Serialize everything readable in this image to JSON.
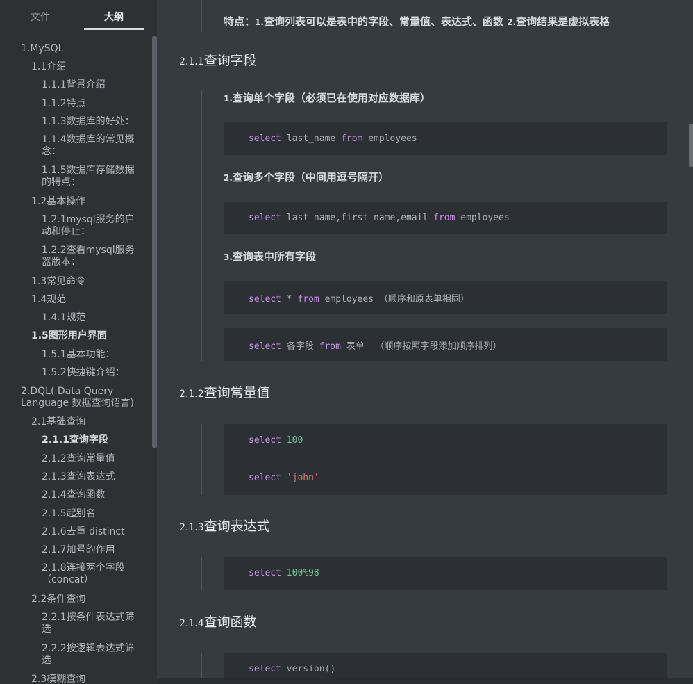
{
  "sidebar": {
    "tabs": [
      {
        "label": "文件"
      },
      {
        "label": "大纲"
      }
    ],
    "outline": [
      {
        "label": "1.MySQL"
      },
      {
        "label": "1.1介绍"
      },
      {
        "label": "1.1.1背景介绍"
      },
      {
        "label": "1.1.2特点"
      },
      {
        "label": "1.1.3数据库的好处："
      },
      {
        "label": "1.1.4数据库的常见概念："
      },
      {
        "label": "1.1.5数据库存储数据的特点："
      },
      {
        "label": "1.2基本操作"
      },
      {
        "label": "1.2.1mysql服务的启动和停止："
      },
      {
        "label": "1.2.2查看mysql服务器版本："
      },
      {
        "label": "1.3常见命令"
      },
      {
        "label": "1.4规范"
      },
      {
        "label": "1.4.1规范"
      },
      {
        "label": "1.5图形用户界面"
      },
      {
        "label": "1.5.1基本功能："
      },
      {
        "label": "1.5.2快捷键介绍："
      },
      {
        "label": "2.DQL( Data Query Language 数据查询语言)"
      },
      {
        "label": "2.1基础查询"
      },
      {
        "label": "2.1.1查询字段"
      },
      {
        "label": "2.1.2查询常量值"
      },
      {
        "label": "2.1.3查询表达式"
      },
      {
        "label": "2.1.4查询函数"
      },
      {
        "label": "2.1.5起别名"
      },
      {
        "label": "2.1.6去重 distinct"
      },
      {
        "label": "2.1.7加号的作用"
      },
      {
        "label": "2.1.8连接两个字段（concat）"
      },
      {
        "label": "2.2条件查询"
      },
      {
        "label": "2.2.1按条件表达式筛选"
      },
      {
        "label": "2.2.2按逻辑表达式筛选"
      },
      {
        "label": "2.3模糊查询"
      }
    ]
  },
  "main": {
    "intro": {
      "prefix": "特点：",
      "n1": "1.",
      "t1": "查询列表可以是表中的字段、常量值、表达式、函数",
      "n2": "2.",
      "t2": "查询结果是虚拟表格"
    },
    "h211": {
      "num": "2.1.1",
      "text": "查询字段"
    },
    "bq1": {
      "num": "1.",
      "text": "查询单个字段（必须已在使用对应数据库）"
    },
    "code1": {
      "kw1": "select",
      "a": " last_name ",
      "kw2": "from",
      "b": " employees"
    },
    "bq2": {
      "num": "2.",
      "text": "查询多个字段（中间用逗号隔开）"
    },
    "code2": {
      "kw1": "select",
      "a": " last_name,first_name,email ",
      "kw2": "from",
      "b": " employees"
    },
    "bq3": {
      "num": "3.",
      "text": "查询表中所有字段"
    },
    "code3": {
      "kw1": "select",
      "a": " * ",
      "kw2": "from",
      "b": " employees （顺序和原表单相同）"
    },
    "code4": {
      "kw1": "select",
      "a": " 各字段 ",
      "kw2": "from",
      "b": " 表单  （顺序按照字段添加顺序排列）"
    },
    "h212": {
      "num": "2.1.2",
      "text": "查询常量值"
    },
    "code5": {
      "kw1": "select",
      "v1": "100",
      "kw2": "select",
      "v2": "'john'"
    },
    "h213": {
      "num": "2.1.3",
      "text": "查询表达式"
    },
    "code6": {
      "kw1": "select",
      "v1": "100%98"
    },
    "h214": {
      "num": "2.1.4",
      "text": "查询函数"
    },
    "code7": {
      "kw1": "select",
      "a": " version()"
    }
  }
}
